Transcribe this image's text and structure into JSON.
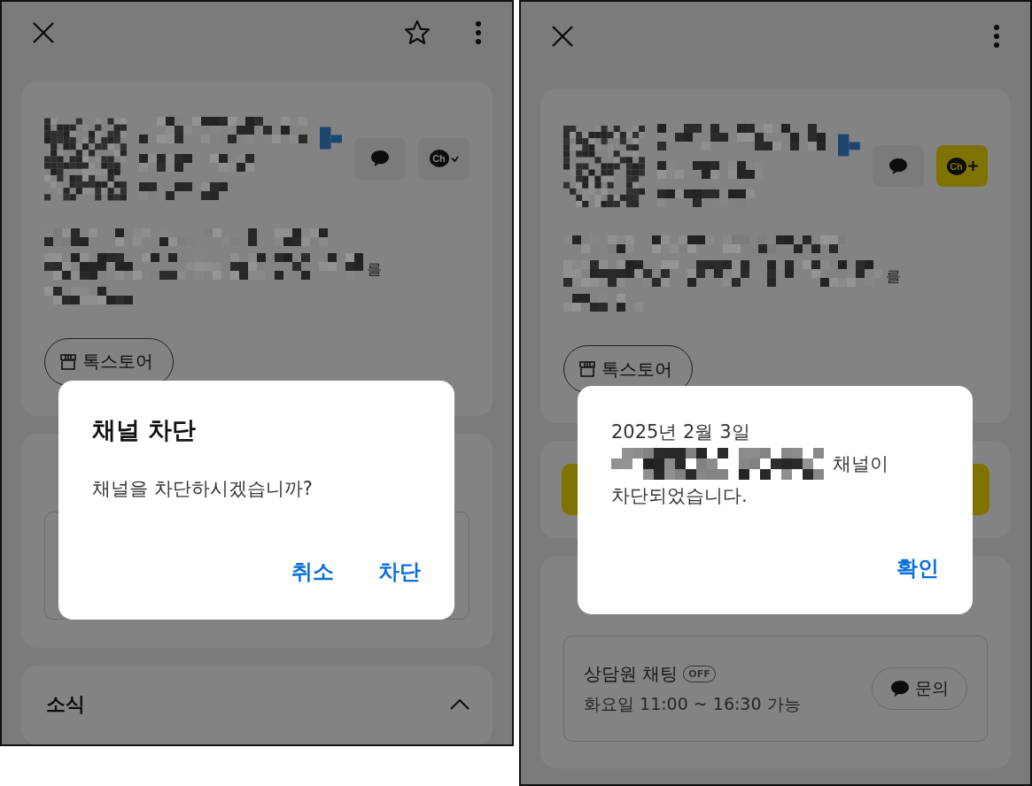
{
  "screens": [
    {
      "top_bar": {
        "star_button": true
      },
      "profile": {
        "channel_added": true,
        "channel_label": "Ch",
        "description_tail": "를",
        "store_button": "톡스토어"
      },
      "sections": [
        {
          "kind": "info_box"
        },
        {
          "kind": "news",
          "title": "소식",
          "expanded": true
        }
      ],
      "dialog": {
        "kind": "confirm",
        "title": "채널 차단",
        "message": "채널을 차단하시겠습니까?",
        "buttons": [
          "취소",
          "차단"
        ]
      }
    },
    {
      "top_bar": {
        "star_button": false
      },
      "profile": {
        "channel_added": false,
        "channel_label": "Ch",
        "description_tail": "를",
        "store_button": "톡스토어"
      },
      "sections": [
        {
          "kind": "add_button"
        },
        {
          "kind": "consult",
          "title": "상담원 채팅",
          "badge": "OFF",
          "hours": "화요일 11:00 ~ 16:30 가능",
          "button": "문의"
        }
      ],
      "dialog": {
        "kind": "result",
        "date": "2025년 2월 3일",
        "name_suffix": "채널이",
        "result": "차단되었습니다.",
        "buttons": [
          "확인"
        ]
      }
    }
  ]
}
